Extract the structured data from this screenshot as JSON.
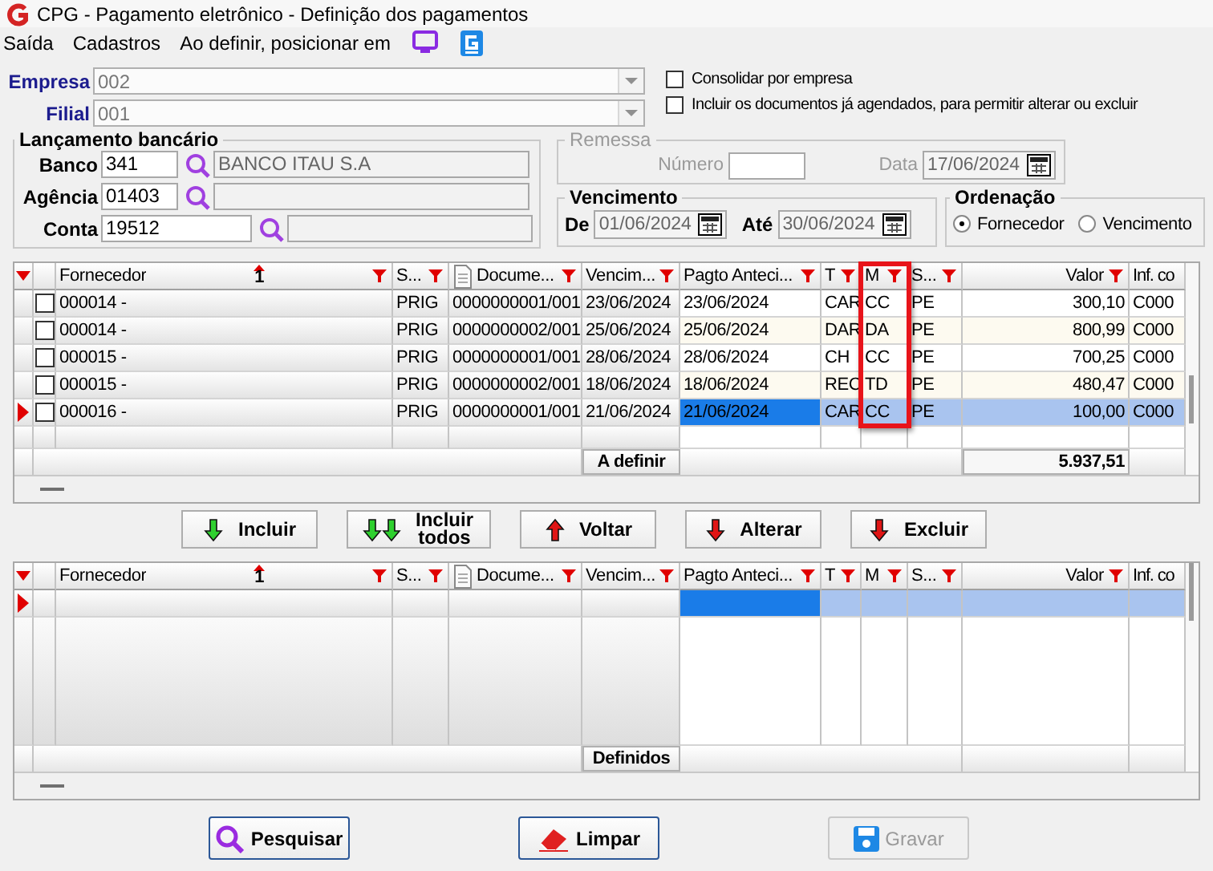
{
  "window": {
    "title": "CPG - Pagamento eletrônico - Definição dos pagamentos"
  },
  "menu": [
    {
      "label": "Saída"
    },
    {
      "label": "Cadastros"
    },
    {
      "label": "Ao definir, posicionar em"
    }
  ],
  "company": [
    {
      "label": "Empresa",
      "value": "002"
    },
    {
      "label": "Filial",
      "value": "001"
    }
  ],
  "options": [
    {
      "label": "Consolidar por empresa",
      "checked": false
    },
    {
      "label": "Incluir os documentos já agendados, para permitir alterar ou excluir",
      "checked": false
    }
  ],
  "lancamento": {
    "title": "Lançamento bancário",
    "fields": [
      {
        "label": "Banco",
        "value": "341",
        "description": "BANCO ITAU S.A"
      },
      {
        "label": "Agência",
        "value": "01403"
      },
      {
        "label": "Conta",
        "value": "19512"
      }
    ]
  },
  "remessa": {
    "title": "Remessa",
    "disabled": true,
    "numero_label": "Número",
    "data_label": "Data",
    "data_value": "17/06/2024"
  },
  "vencimento": {
    "title": "Vencimento",
    "de_label": "De",
    "de_value": "01/06/2024",
    "ate_label": "Até",
    "ate_value": "30/06/2024"
  },
  "ordenacao": {
    "title": "Ordenação",
    "options": [
      {
        "label": "Fornecedor",
        "selected": true
      },
      {
        "label": "Vencimento",
        "selected": false
      }
    ]
  },
  "grid_top": {
    "columns": [
      {
        "label": "Fornecedor",
        "sort_index": "1",
        "editable": false,
        "kind": "text",
        "highlighted": false
      },
      {
        "label": "S...",
        "editable": false,
        "kind": "text",
        "highlighted": false
      },
      {
        "label": "Docume...",
        "editable": false,
        "kind": "document",
        "highlighted": false
      },
      {
        "label": "Vencim...",
        "editable": false,
        "kind": "text",
        "highlighted": false
      },
      {
        "label": "Pagto Anteci...",
        "editable": true,
        "kind": "text",
        "highlighted": false
      },
      {
        "label": "T",
        "editable": true,
        "kind": "text",
        "highlighted": false
      },
      {
        "label": "M",
        "editable": true,
        "kind": "text",
        "highlighted": true
      },
      {
        "label": "S...",
        "editable": true,
        "kind": "text",
        "highlighted": false
      },
      {
        "label": "Valor",
        "editable": true,
        "kind": "number",
        "highlighted": false
      },
      {
        "label": "Inf. co",
        "editable": true,
        "kind": "text",
        "highlighted": false
      }
    ],
    "rows": [
      {
        "checked": false,
        "selected": false,
        "cells": [
          "000014 -",
          "PRIG",
          "0000000001/001",
          "23/06/2024",
          "23/06/2024",
          "CAR",
          "CC",
          "PE",
          "300,10",
          "C000"
        ]
      },
      {
        "checked": false,
        "selected": false,
        "cells": [
          "000014 -",
          "PRIG",
          "0000000002/001",
          "25/06/2024",
          "25/06/2024",
          "DAR",
          "DA",
          "PE",
          "800,99",
          "C000"
        ]
      },
      {
        "checked": false,
        "selected": false,
        "cells": [
          "000015 -",
          "PRIG",
          "0000000001/001",
          "28/06/2024",
          "28/06/2024",
          "CH",
          "CC",
          "PE",
          "700,25",
          "C000"
        ]
      },
      {
        "checked": false,
        "selected": false,
        "cells": [
          "000015 -",
          "PRIG",
          "0000000002/001",
          "18/06/2024",
          "18/06/2024",
          "REC",
          "TD",
          "PE",
          "480,47",
          "C000"
        ]
      },
      {
        "checked": false,
        "selected": true,
        "cells": [
          "000016 -",
          "PRIG",
          "0000000001/001",
          "21/06/2024",
          "21/06/2024",
          "CAR",
          "CC",
          "PE",
          "100,00",
          "C000"
        ]
      }
    ],
    "total_label": "A definir",
    "total": "5.937,51"
  },
  "transfer_buttons": [
    {
      "label": "Incluir",
      "kind": "down"
    },
    {
      "label": "Incluir todos",
      "kind": "down-double"
    },
    {
      "label": "Voltar",
      "kind": "up"
    },
    {
      "label": "Alterar",
      "kind": "down-red"
    },
    {
      "label": "Excluir",
      "kind": "down-red"
    }
  ],
  "grid_bottom": {
    "columns": [
      {
        "label": "Fornecedor",
        "sort_index": "1",
        "editable": false,
        "kind": "text",
        "highlighted": false
      },
      {
        "label": "S...",
        "editable": false,
        "kind": "text",
        "highlighted": false
      },
      {
        "label": "Docume...",
        "editable": false,
        "kind": "document",
        "highlighted": false
      },
      {
        "label": "Vencim...",
        "editable": false,
        "kind": "text",
        "highlighted": false
      },
      {
        "label": "Pagto Anteci...",
        "editable": true,
        "kind": "text",
        "highlighted": false
      },
      {
        "label": "T",
        "editable": true,
        "kind": "text",
        "highlighted": false
      },
      {
        "label": "M",
        "editable": true,
        "kind": "text",
        "highlighted": false
      },
      {
        "label": "S...",
        "editable": true,
        "kind": "text",
        "highlighted": false
      },
      {
        "label": "Valor",
        "editable": true,
        "kind": "number",
        "highlighted": false
      },
      {
        "label": "Inf. co",
        "editable": true,
        "kind": "text",
        "highlighted": false
      }
    ],
    "rows": [
      {
        "selected": true
      }
    ],
    "total_label": "Definidos"
  },
  "actions": [
    {
      "label": "Pesquisar",
      "kind": "search",
      "disabled": false
    },
    {
      "label": "Limpar",
      "kind": "eraser",
      "disabled": false
    },
    {
      "label": "Gravar",
      "kind": "save",
      "disabled": true
    }
  ]
}
